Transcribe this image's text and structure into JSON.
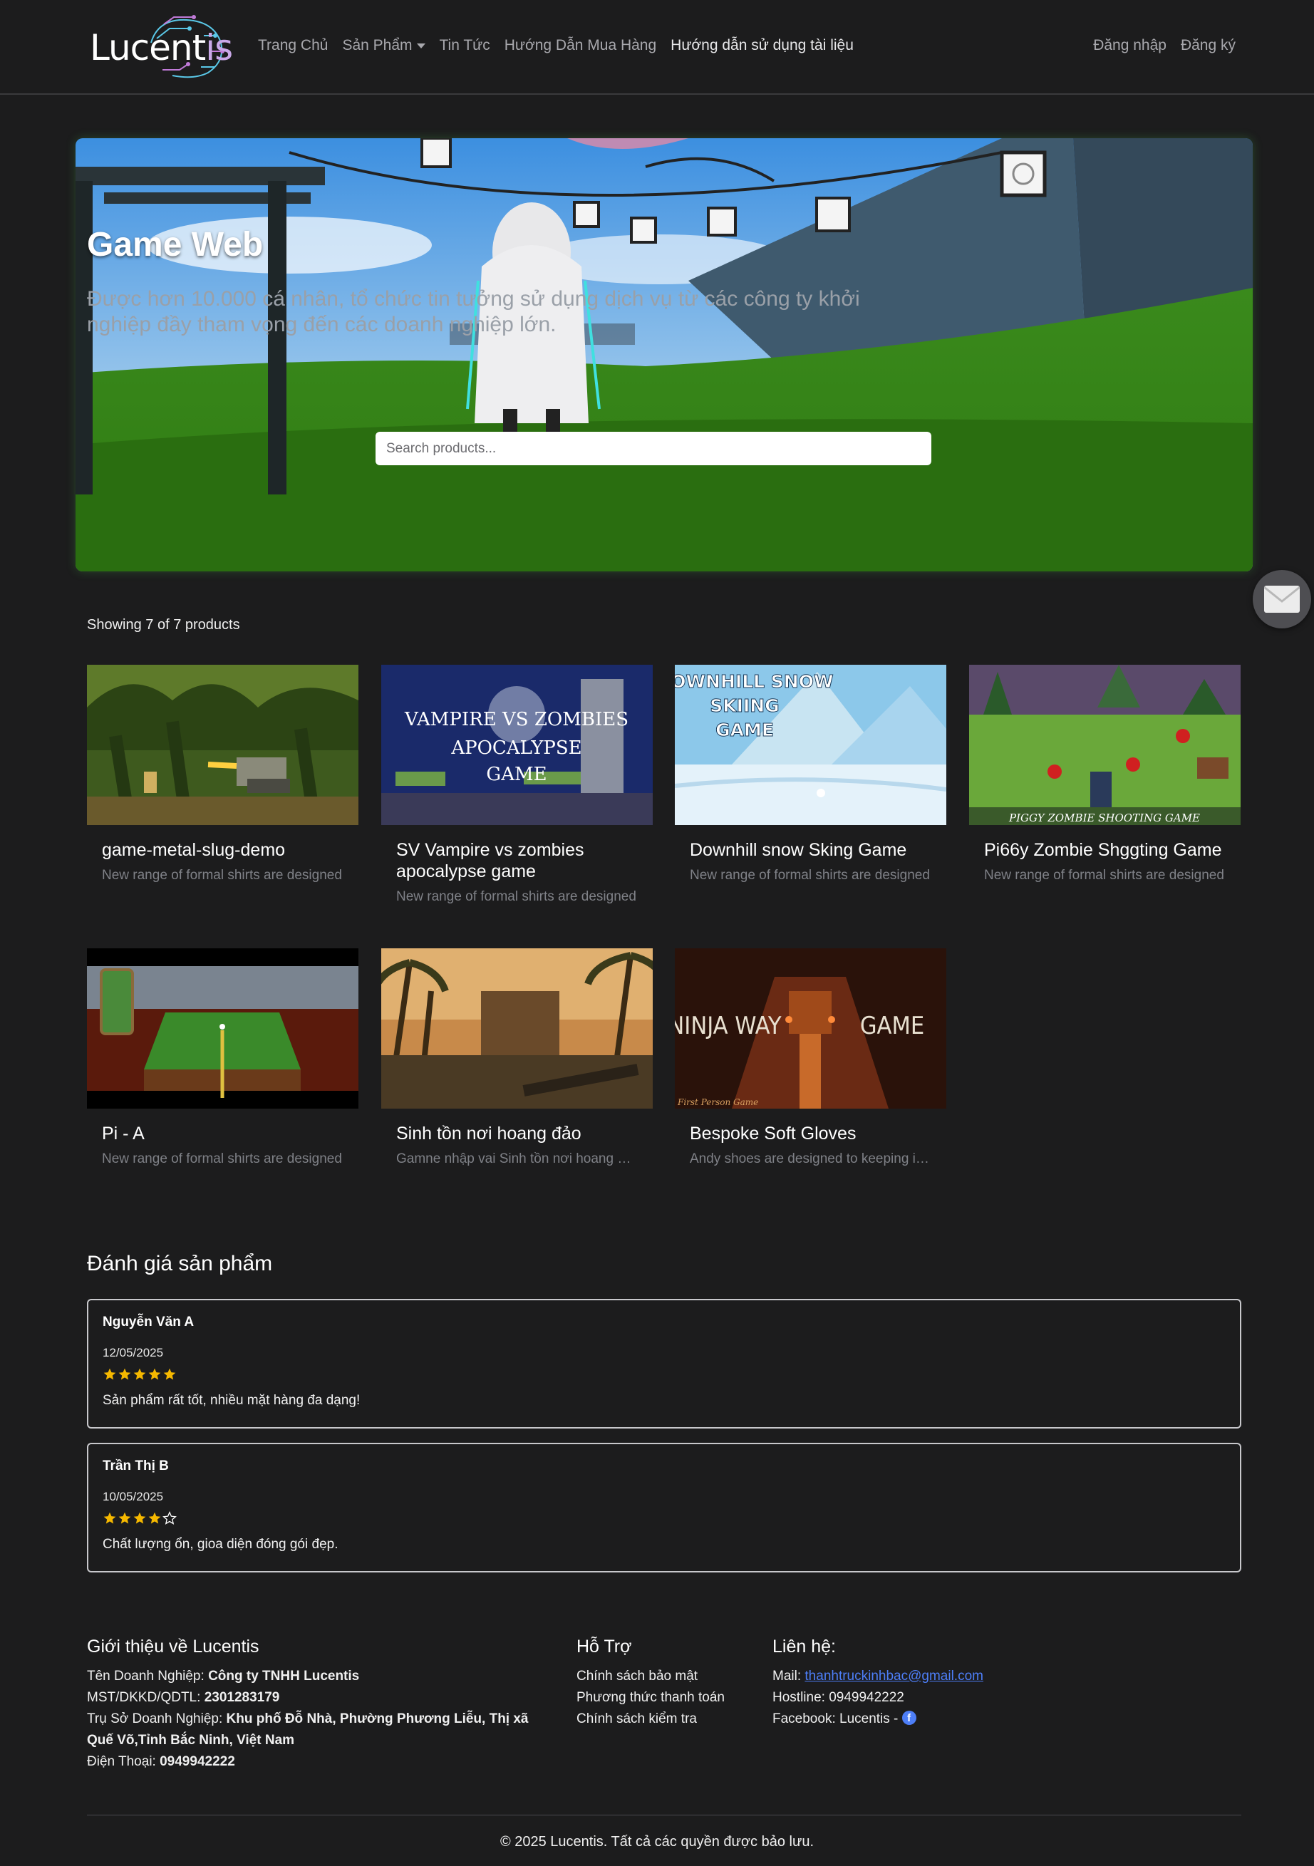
{
  "brand": {
    "logo_text_main": "Lucent",
    "logo_text_accent": "is"
  },
  "nav": {
    "items": [
      {
        "label": "Trang Chủ"
      },
      {
        "label": "Sản Phẩm"
      },
      {
        "label": "Tin Tức"
      },
      {
        "label": "Hướng Dẫn Mua Hàng"
      },
      {
        "label": "Hướng dẫn sử dụng tài liệu"
      }
    ],
    "login": "Đăng nhập",
    "register": "Đăng ký"
  },
  "hero": {
    "title": "Game Web",
    "subtitle": "Được hơn 10.000 cá nhân, tổ chức tin tưởng sử dụng dịch vụ từ các công ty khởi nghiệp đầy tham vọng đến các doanh nghiệp lớn.",
    "search_placeholder": "Search products..."
  },
  "products": {
    "showing": "Showing 7 of 7 products",
    "items": [
      {
        "title": "game-metal-slug-demo",
        "desc": "New range of formal shirts are designed"
      },
      {
        "title": "SV Vampire vs zombies apocalypse game",
        "desc": "New range of formal shirts are designed"
      },
      {
        "title": "Downhill snow Sking Game",
        "desc": "New range of formal shirts are designed"
      },
      {
        "title": "Pi66y Zombie Shggting Game",
        "desc": "New range of formal shirts are designed"
      },
      {
        "title": "Pi - A",
        "desc": "New range of formal shirts are designed"
      },
      {
        "title": "Sinh tồn nơi hoang đảo",
        "desc": "Gamne nhập vai Sinh tồn nơi hoang đảo"
      },
      {
        "title": "Bespoke Soft Gloves",
        "desc": "Andy shoes are designed to keeping in mind"
      }
    ],
    "image_text": {
      "vampire": [
        "VAMPIRE VS ZOMBIES",
        "APOCALYPSE",
        "GAME"
      ],
      "downhill": [
        "DOWNHILL SNOW",
        "SKIING",
        "GAME"
      ],
      "piggy": "PIGGY ZOMBIE SHOOTING GAME",
      "ninja_left": "NINJA WAY",
      "ninja_right": "GAME",
      "ninja_small": "First Person Game"
    }
  },
  "reviews": {
    "title": "Đánh giá sản phẩm",
    "items": [
      {
        "name": "Nguyễn Văn A",
        "date": "12/05/2025",
        "rating": 5,
        "text": "Sản phẩm rất tốt, nhiều mặt hàng đa dạng!"
      },
      {
        "name": "Trần Thị B",
        "date": "10/05/2025",
        "rating": 4,
        "text": "Chất lượng ổn, gioa diện đóng gói đẹp."
      }
    ]
  },
  "footer": {
    "about": {
      "title": "Giới thiệu về Lucentis",
      "company_label": "Tên Doanh Nghiệp:",
      "company_value": "Công ty TNHH Lucentis",
      "tax_label": "MST/DKKD/QDTL:",
      "tax_value": "2301283179",
      "address_label": "Trụ Sở Doanh Nghiệp:",
      "address_value": "Khu phố Đỗ Nhà, Phường Phương Liễu, Thị xã Quế Võ,Tỉnh Bắc Ninh, Việt Nam",
      "phone_label": "Điện Thoại:",
      "phone_value": "0949942222"
    },
    "support": {
      "title": "Hỗ Trợ",
      "links": [
        "Chính sách bảo mật",
        "Phương thức thanh toán",
        "Chính sách kiểm tra"
      ]
    },
    "contact": {
      "title": "Liên hệ:",
      "mail_label": "Mail:",
      "mail_value": "thanhtruckinhbac@gmail.com",
      "hotline_label": "Hostline:",
      "hotline_value": "0949942222",
      "facebook_label": "Facebook: Lucentis -"
    },
    "copyright": "© 2025 Lucentis. Tất cả các quyền được bảo lưu."
  },
  "colors": {
    "background": "#1c1c1d",
    "star": "#f5b800",
    "link": "#4d7ef7"
  },
  "icons": [
    "mail-icon",
    "facebook-icon",
    "star-icon",
    "caret-down-icon"
  ]
}
